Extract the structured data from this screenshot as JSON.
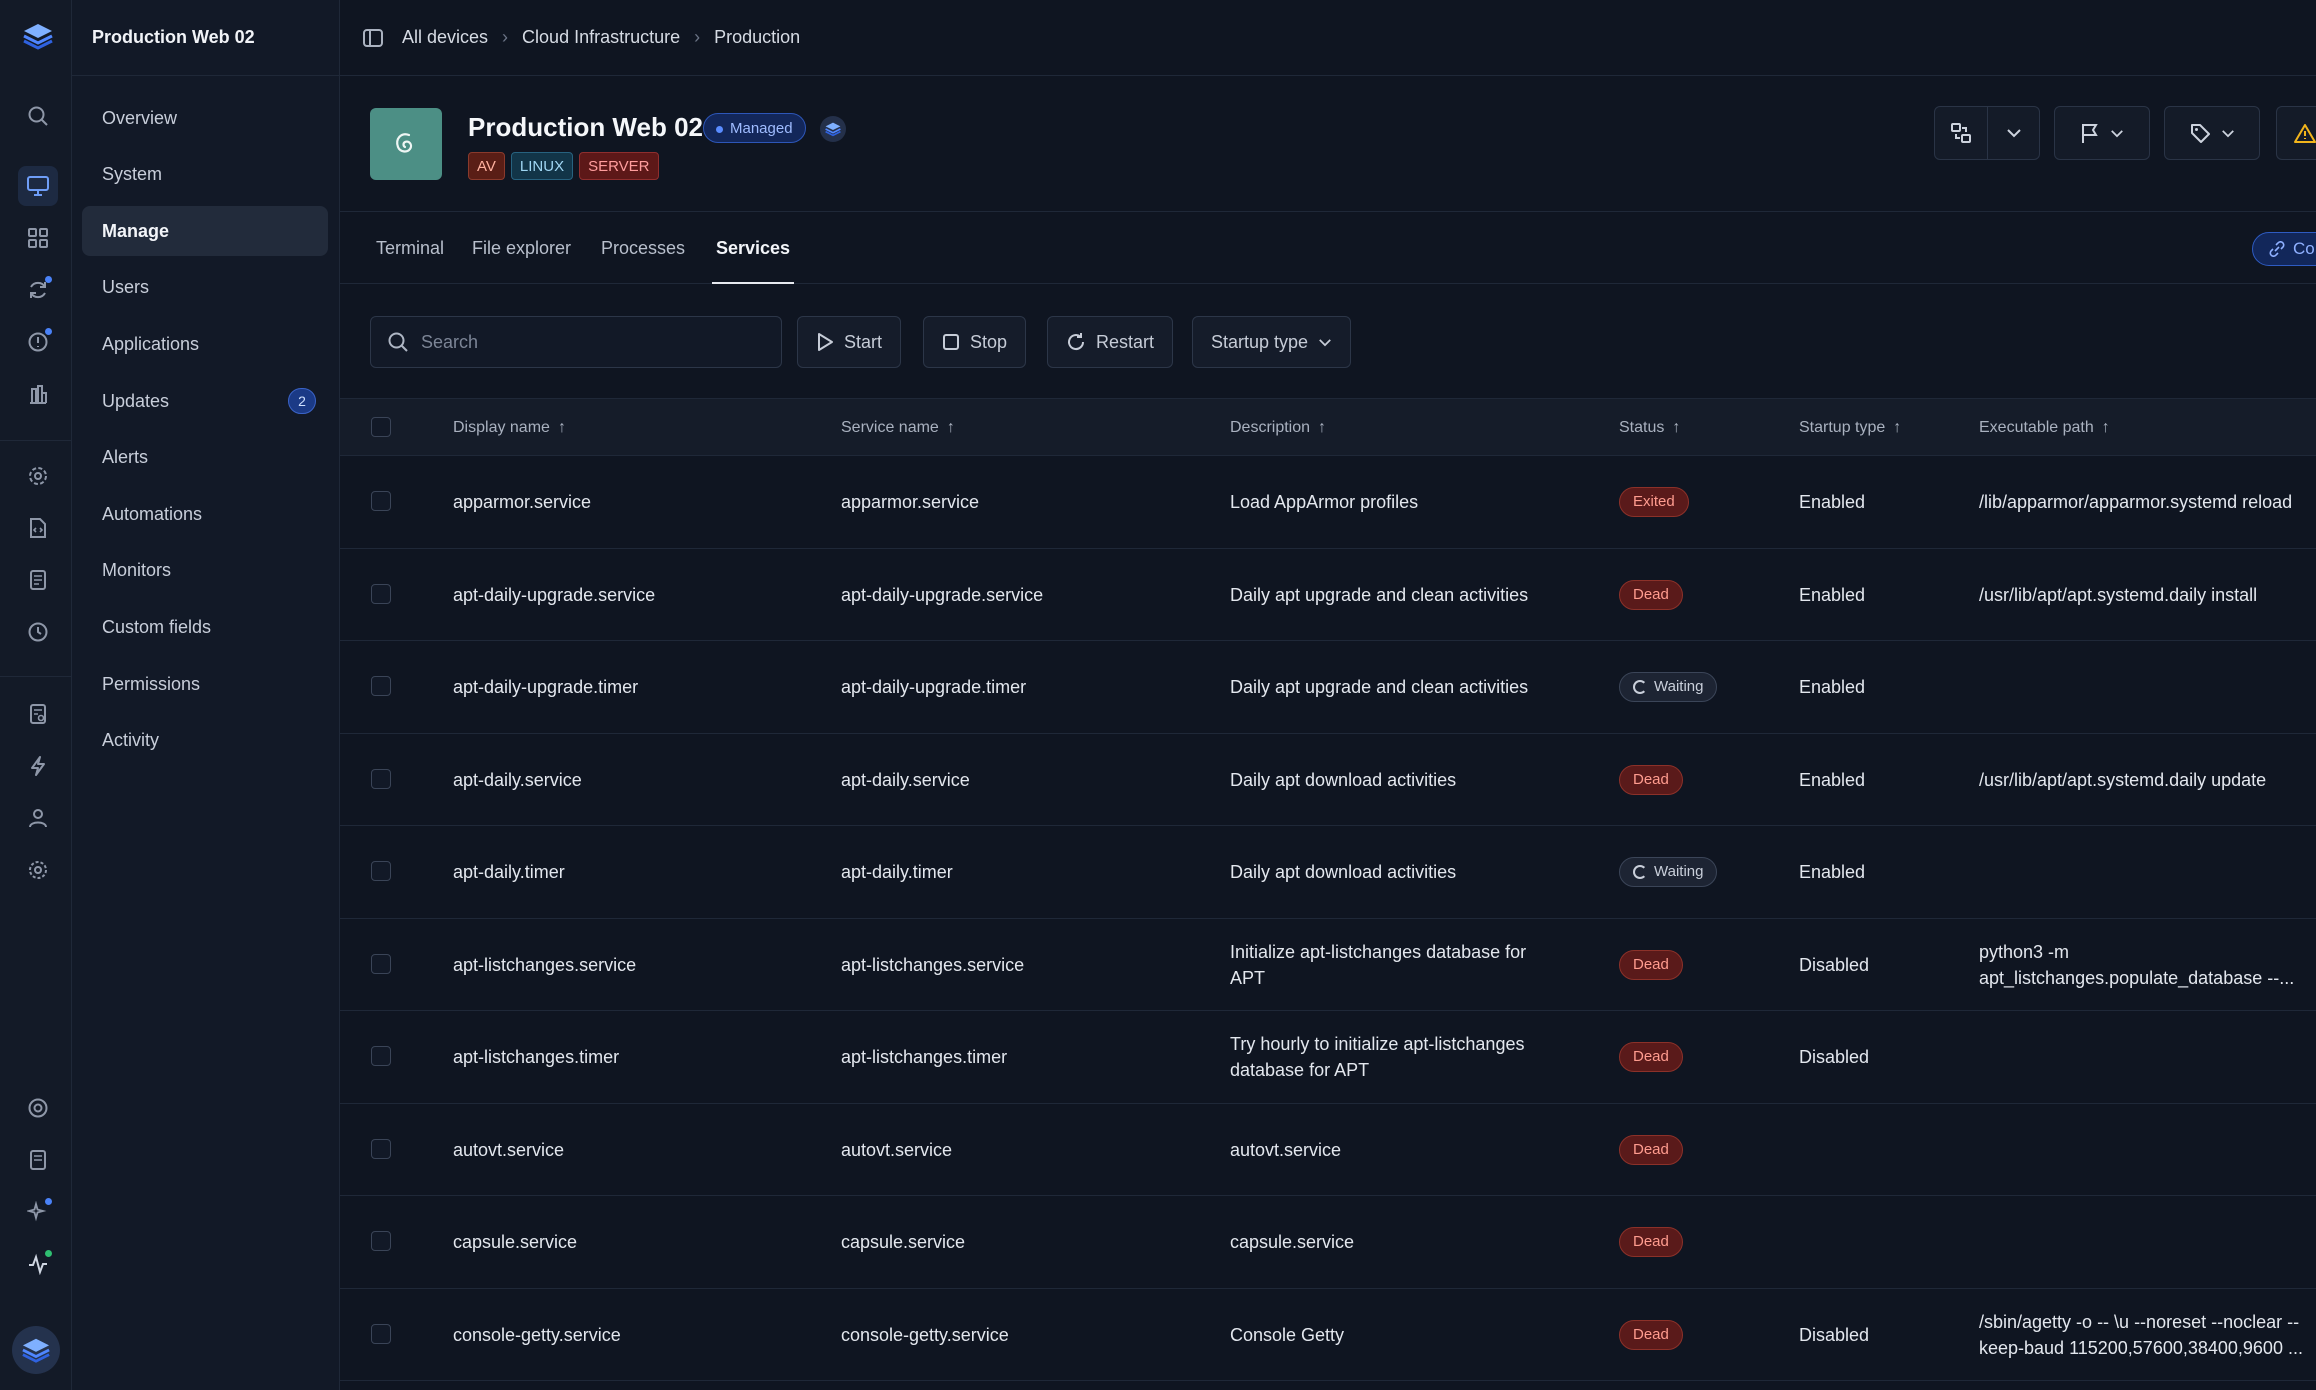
{
  "workspace": {
    "name": "Production Web 02"
  },
  "nav": {
    "items": [
      {
        "label": "Overview"
      },
      {
        "label": "System"
      },
      {
        "label": "Manage"
      },
      {
        "label": "Users"
      },
      {
        "label": "Applications"
      },
      {
        "label": "Updates",
        "badge": "2"
      },
      {
        "label": "Alerts"
      },
      {
        "label": "Automations"
      },
      {
        "label": "Monitors"
      },
      {
        "label": "Custom fields"
      },
      {
        "label": "Permissions"
      },
      {
        "label": "Activity"
      }
    ]
  },
  "breadcrumb": [
    "All devices",
    "Cloud Infrastructure",
    "Production"
  ],
  "device": {
    "name": "Production Web 02",
    "status": "Managed",
    "tags": [
      "AV",
      "LINUX",
      "SERVER"
    ]
  },
  "tabs": [
    "Terminal",
    "File explorer",
    "Processes",
    "Services"
  ],
  "connect_label": "Co",
  "toolbar": {
    "search_placeholder": "Search",
    "start": "Start",
    "stop": "Stop",
    "restart": "Restart",
    "startup_type": "Startup type"
  },
  "table": {
    "columns": [
      "Display name",
      "Service name",
      "Description",
      "Status",
      "Startup type",
      "Executable path"
    ],
    "rows": [
      {
        "display": "apparmor.service",
        "service": "apparmor.service",
        "desc": [
          "Load AppArmor profiles"
        ],
        "status": "Exited",
        "startup": "Enabled",
        "path": [
          "/lib/apparmor/apparmor.systemd reload"
        ]
      },
      {
        "display": "apt-daily-upgrade.service",
        "service": "apt-daily-upgrade.service",
        "desc": [
          "Daily apt upgrade and clean activities"
        ],
        "status": "Dead",
        "startup": "Enabled",
        "path": [
          "/usr/lib/apt/apt.systemd.daily install"
        ]
      },
      {
        "display": "apt-daily-upgrade.timer",
        "service": "apt-daily-upgrade.timer",
        "desc": [
          "Daily apt upgrade and clean activities"
        ],
        "status": "Waiting",
        "startup": "Enabled",
        "path": []
      },
      {
        "display": "apt-daily.service",
        "service": "apt-daily.service",
        "desc": [
          "Daily apt download activities"
        ],
        "status": "Dead",
        "startup": "Enabled",
        "path": [
          "/usr/lib/apt/apt.systemd.daily update"
        ]
      },
      {
        "display": "apt-daily.timer",
        "service": "apt-daily.timer",
        "desc": [
          "Daily apt download activities"
        ],
        "status": "Waiting",
        "startup": "Enabled",
        "path": []
      },
      {
        "display": "apt-listchanges.service",
        "service": "apt-listchanges.service",
        "desc": [
          "Initialize apt-listchanges database for",
          "APT"
        ],
        "status": "Dead",
        "startup": "Disabled",
        "path": [
          "python3 -m",
          "apt_listchanges.populate_database --..."
        ]
      },
      {
        "display": "apt-listchanges.timer",
        "service": "apt-listchanges.timer",
        "desc": [
          "Try hourly to initialize apt-listchanges",
          "database for APT"
        ],
        "status": "Dead",
        "startup": "Disabled",
        "path": []
      },
      {
        "display": "autovt.service",
        "service": "autovt.service",
        "desc": [
          "autovt.service"
        ],
        "status": "Dead",
        "startup": "",
        "path": []
      },
      {
        "display": "capsule.service",
        "service": "capsule.service",
        "desc": [
          "capsule.service"
        ],
        "status": "Dead",
        "startup": "",
        "path": []
      },
      {
        "display": "console-getty.service",
        "service": "console-getty.service",
        "desc": [
          "Console Getty"
        ],
        "status": "Dead",
        "startup": "Disabled",
        "path": [
          "/sbin/agetty -o -- \\u --noreset --noclear --",
          "keep-baud 115200,57600,38400,9600 ..."
        ]
      }
    ]
  }
}
